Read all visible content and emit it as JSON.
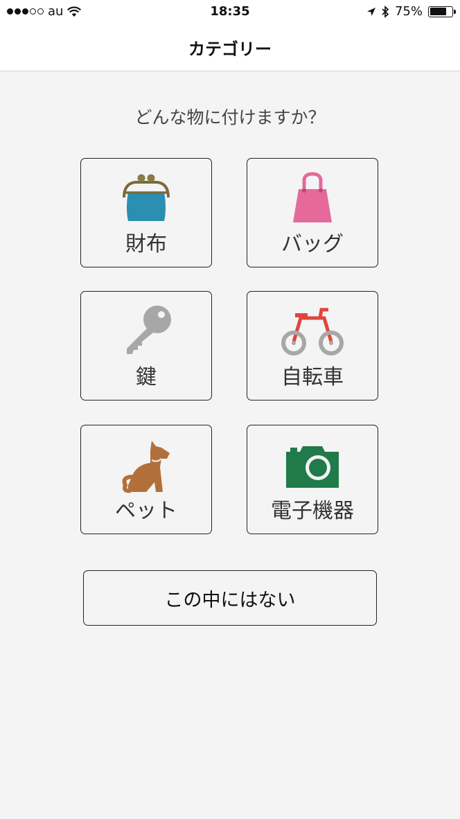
{
  "status_bar": {
    "carrier": "au",
    "time": "18:35",
    "battery_percent": "75%",
    "battery_level": 0.75,
    "signal_icon": "signal-dots-icon",
    "wifi_icon": "wifi-icon",
    "location_icon": "location-arrow-icon",
    "bluetooth_icon": "bluetooth-icon"
  },
  "nav": {
    "title": "カテゴリー"
  },
  "question": "どんな物に付けますか？",
  "categories": [
    {
      "label": "財布",
      "icon": "coin-purse-icon",
      "color": "#2a8fb0"
    },
    {
      "label": "バッグ",
      "icon": "handbag-icon",
      "color": "#e5699a"
    },
    {
      "label": "鍵",
      "icon": "key-icon",
      "color": "#a7a7a7"
    },
    {
      "label": "自転車",
      "icon": "bicycle-icon",
      "color": "#e0453c"
    },
    {
      "label": "ペット",
      "icon": "dog-icon",
      "color": "#b1703a"
    },
    {
      "label": "電子機器",
      "icon": "camera-icon",
      "color": "#217a4a"
    }
  ],
  "none_button": "この中にはない"
}
